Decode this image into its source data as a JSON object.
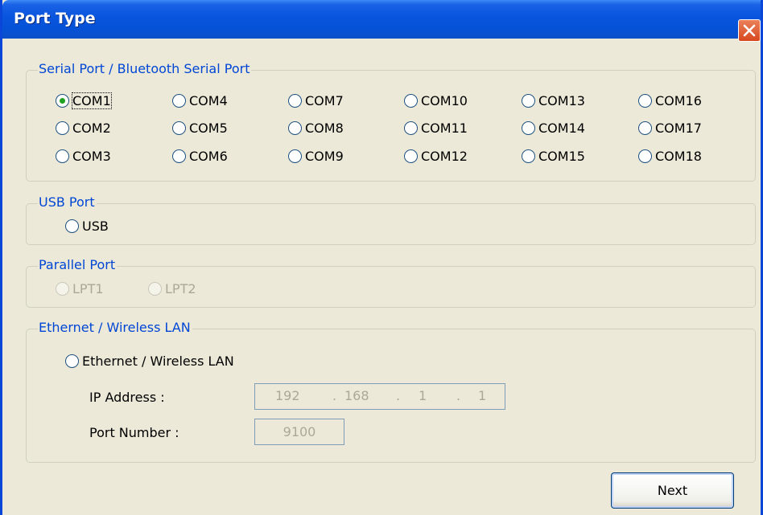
{
  "window": {
    "title": "Port Type",
    "close_icon": "close-icon"
  },
  "serial": {
    "legend": "Serial Port / Bluetooth Serial Port",
    "ports": [
      "COM1",
      "COM2",
      "COM3",
      "COM4",
      "COM5",
      "COM6",
      "COM7",
      "COM8",
      "COM9",
      "COM10",
      "COM11",
      "COM12",
      "COM13",
      "COM14",
      "COM15",
      "COM16",
      "COM17",
      "COM18"
    ],
    "selected": "COM1"
  },
  "usb": {
    "legend": "USB Port",
    "option": "USB"
  },
  "parallel": {
    "legend": "Parallel Port",
    "options": [
      "LPT1",
      "LPT2"
    ]
  },
  "ethernet": {
    "legend": "Ethernet / Wireless LAN",
    "option": "Ethernet / Wireless LAN",
    "ip_label": "IP Address :",
    "ip_octets": [
      "192",
      "168",
      "1",
      "1"
    ],
    "ip_separator": ".",
    "port_label": "Port Number :",
    "port_value": "9100"
  },
  "buttons": {
    "next": "Next"
  },
  "colors": {
    "title_bar": "#0854dd",
    "legend_text": "#0046d5",
    "dialog_bg": "#ece9d8",
    "radio_dot": "#21a121"
  }
}
